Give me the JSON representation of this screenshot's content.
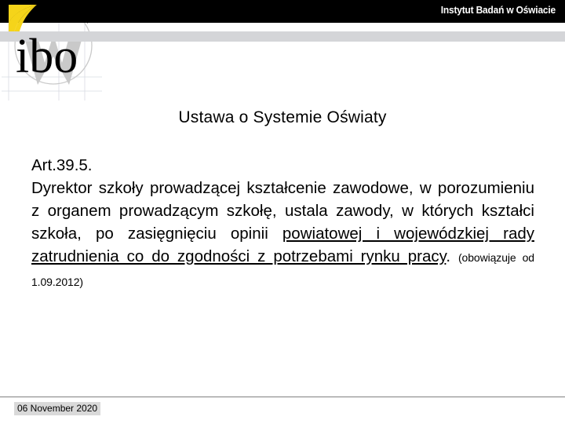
{
  "header": {
    "organization": "Instytut Badań w Oświacie",
    "logo_text": "ibo",
    "colors": {
      "band": "#000000",
      "accent_yellow": "#F5D41A",
      "gray_band": "#D4D5D8",
      "watermark_gray": "#C9C9C9"
    }
  },
  "slide": {
    "title": "Ustawa o Systemie Oświaty",
    "article_label": "Art.39.5.",
    "paragraph": {
      "plain_1": "Dyrektor szkoły prowadzącej kształcenie zawodowe, w porozumieniu z organem prowadzącym szkołę, ustala zawody, w których kształci szkoła, po zasięgnięciu opinii ",
      "underlined_1": "powiatowej i wojewódzkiej rady zatrudnienia co do zgodności z potrzebami rynku pracy",
      "plain_2": ". ",
      "note": "(obowiązuje od 1.09.2012)"
    }
  },
  "footer": {
    "date": "06 November 2020"
  }
}
